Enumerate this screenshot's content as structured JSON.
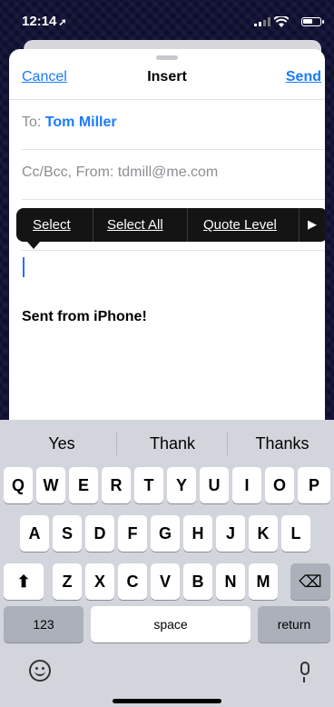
{
  "status_bar": {
    "time": "12:14"
  },
  "nav": {
    "cancel": "Cancel",
    "title": "Insert",
    "send": "Send"
  },
  "fields": {
    "to_label": "To:",
    "to_value": "Tom Miller",
    "cc_from": "Cc/Bcc, From: tdmill@me.com"
  },
  "edit_menu": {
    "select": "Select",
    "select_all": "Select All",
    "quote_level": "Quote Level",
    "more": "▶"
  },
  "body": {
    "text": "Sent from iPhone!"
  },
  "keyboard": {
    "suggestions": [
      "Yes",
      "Thank",
      "Thanks"
    ],
    "row1": [
      "Q",
      "W",
      "E",
      "R",
      "T",
      "Y",
      "U",
      "I",
      "O",
      "P"
    ],
    "row2": [
      "A",
      "S",
      "D",
      "F",
      "G",
      "H",
      "J",
      "K",
      "L"
    ],
    "row3": [
      "Z",
      "X",
      "C",
      "V",
      "B",
      "N",
      "M"
    ],
    "shift": "⬆",
    "delete": "⌫",
    "numbers": "123",
    "space": "space",
    "return": "return"
  },
  "colors": {
    "accent": "#1a7bff",
    "cursor": "#2d6bff",
    "keyboard_bg": "#d2d5db"
  }
}
